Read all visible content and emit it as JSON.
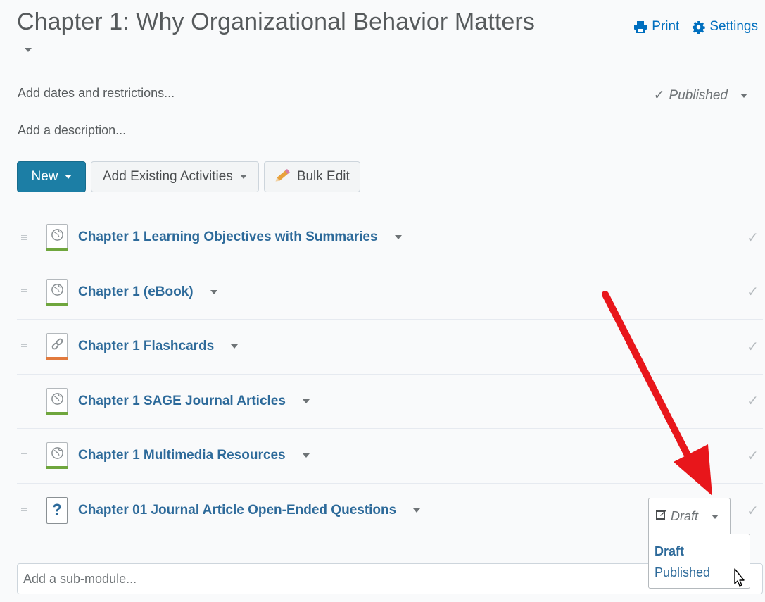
{
  "header": {
    "title": "Chapter 1: Why Organizational Behavior Matters",
    "print_label": "Print",
    "settings_label": "Settings"
  },
  "meta": {
    "dates_link": "Add dates and restrictions...",
    "description_link": "Add a description...",
    "published_status": "Published"
  },
  "toolbar": {
    "new_label": "New",
    "add_existing_label": "Add Existing Activities",
    "bulk_edit_label": "Bulk Edit"
  },
  "activities": [
    {
      "title": "Chapter 1 Learning Objectives with Summaries",
      "icon": "web-page-icon",
      "bar_color": "#6fa63d"
    },
    {
      "title": "Chapter 1 (eBook)",
      "icon": "web-page-icon",
      "bar_color": "#6fa63d"
    },
    {
      "title": "Chapter 1 Flashcards",
      "icon": "link-icon",
      "bar_color": "#e27a3d"
    },
    {
      "title": "Chapter 1 SAGE Journal Articles",
      "icon": "web-page-icon",
      "bar_color": "#6fa63d"
    },
    {
      "title": "Chapter 1 Multimedia Resources",
      "icon": "web-page-icon",
      "bar_color": "#6fa63d"
    },
    {
      "title": "Chapter 01 Journal Article Open-Ended Questions",
      "icon": "question-icon",
      "bar_color": ""
    }
  ],
  "status_dropdown": {
    "current": "Draft",
    "options": [
      "Draft",
      "Published"
    ]
  },
  "sub_module": {
    "placeholder": "Add a sub-module..."
  },
  "colors": {
    "accent": "#1c7ea5",
    "link": "#2d6a9a",
    "annotation_arrow": "#e8161b"
  }
}
